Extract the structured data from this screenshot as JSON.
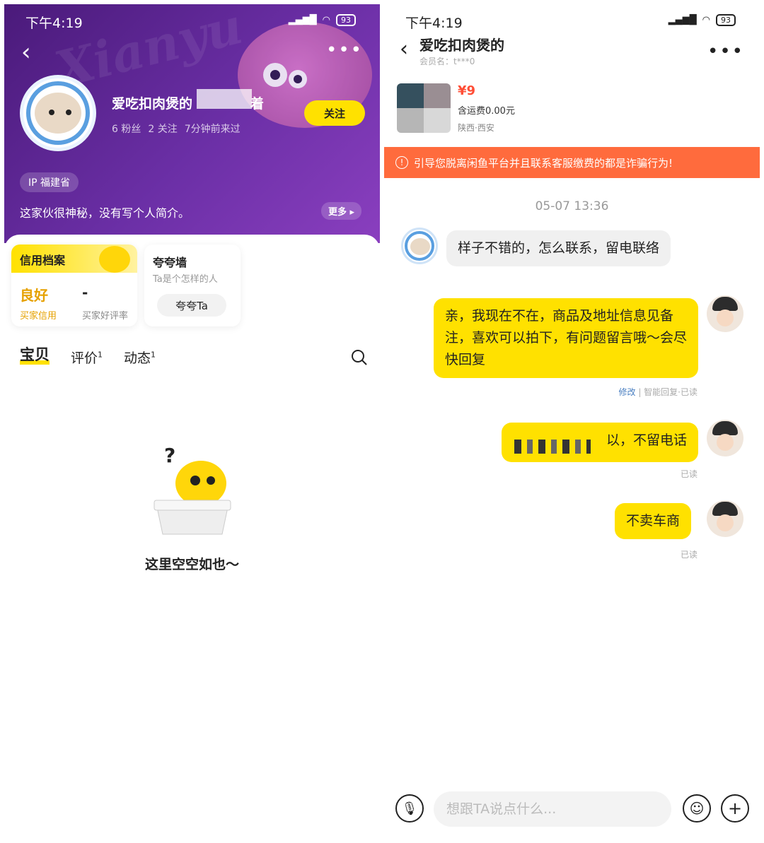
{
  "left": {
    "status": {
      "time": "下午4:19",
      "battery": "93"
    },
    "profile": {
      "nickname_visible": "爱吃扣肉煲的",
      "nickname_tail": "着",
      "fans": "6 粉丝",
      "following": "2 关注",
      "last_seen": "7分钟前来过",
      "follow_label": "关注",
      "ip": "IP 福建省",
      "bio": "这家伙很神秘，没有写个人简介。",
      "more_label": "更多"
    },
    "credit": {
      "title": "信用档案",
      "buyer_credit_value": "良好",
      "buyer_credit_label": "买家信用",
      "buyer_rating_value": "-",
      "buyer_rating_label": "买家好评率"
    },
    "praise": {
      "title": "夸夸墙",
      "subtitle": "Ta是个怎样的人",
      "button": "夸夸Ta"
    },
    "tabs": [
      {
        "label": "宝贝",
        "count": ""
      },
      {
        "label": "评价",
        "count": "1"
      },
      {
        "label": "动态",
        "count": "1"
      }
    ],
    "empty_text": "这里空空如也～"
  },
  "right": {
    "status": {
      "time": "下午4:19",
      "battery": "93"
    },
    "header": {
      "title": "爱吃扣肉煲的",
      "member": "会员名：t***0"
    },
    "product": {
      "price": "¥9",
      "shipping": "含运费0.00元",
      "location": "陕西·西安"
    },
    "warning": "引导您脱离闲鱼平台并且联系客服缴费的都是诈骗行为!",
    "timestamp": "05-07 13:36",
    "messages": [
      {
        "side": "in",
        "text": "样子不错的，怎么联系，留电联络"
      },
      {
        "side": "out",
        "text": "亲，我现在不在，商品及地址信息见备注，喜欢可以拍下，有问题留言哦～会尽快回复",
        "meta_edit": "修改",
        "meta_rest": " | 智能回复·已读"
      },
      {
        "side": "out",
        "text": "以，不留电话",
        "meta_rest": "已读"
      },
      {
        "side": "out",
        "text": "不卖车商",
        "meta_rest": "已读"
      }
    ],
    "input_placeholder": "想跟TA说点什么..."
  },
  "colors": {
    "accent_yellow": "#ffe100",
    "hero_purple": "#6b2fa6",
    "warning_orange": "#ff6b3d"
  }
}
